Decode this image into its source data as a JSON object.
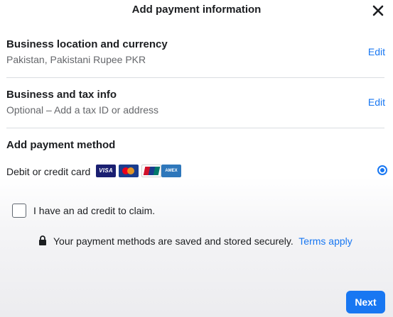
{
  "header": {
    "title": "Add payment information",
    "close_icon": "close-icon"
  },
  "location": {
    "title": "Business location and currency",
    "subtitle": "Pakistan, Pakistani Rupee PKR",
    "edit_label": "Edit"
  },
  "tax": {
    "title": "Business and tax info",
    "subtitle": "Optional – Add a tax ID or address",
    "edit_label": "Edit"
  },
  "payment": {
    "title": "Add payment method",
    "method_label": "Debit or credit card",
    "cards": [
      "visa-card-icon",
      "mastercard-icon",
      "unionpay-icon",
      "amex-card-icon"
    ],
    "visa_text": "VISA",
    "amex_text": "AMEX",
    "selected": true
  },
  "ad_credit": {
    "label": "I have an ad credit to claim.",
    "checked": false
  },
  "security": {
    "text": "Your payment methods are saved and stored securely.",
    "terms_label": "Terms apply"
  },
  "footer": {
    "next_label": "Next"
  },
  "colors": {
    "accent": "#1877f2",
    "text": "#1c1e21",
    "muted": "#65676b",
    "divider": "#dadde1"
  }
}
